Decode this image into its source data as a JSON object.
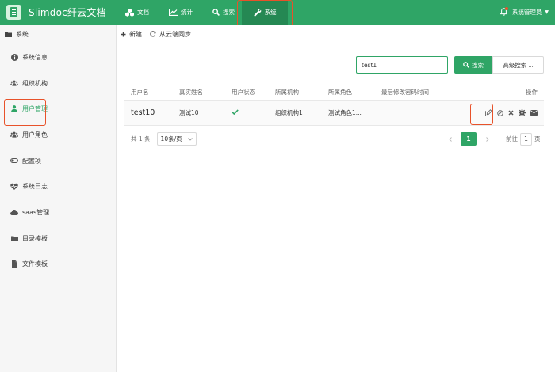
{
  "app": {
    "name": "Slimdoc纤云文档"
  },
  "nav": {
    "items": [
      {
        "label": "文档",
        "icon": "cubes-icon"
      },
      {
        "label": "统计",
        "icon": "line-chart-icon"
      },
      {
        "label": "搜索",
        "icon": "search-icon"
      },
      {
        "label": "系统",
        "icon": "wrench-icon",
        "active": true
      }
    ],
    "user": "系统管理员"
  },
  "sidebar": {
    "header": "系统",
    "items": [
      {
        "label": "系统信息",
        "icon": "info-icon"
      },
      {
        "label": "组织机构",
        "icon": "users-icon"
      },
      {
        "label": "用户管理",
        "icon": "user-icon",
        "active": true
      },
      {
        "label": "用户角色",
        "icon": "users-icon"
      },
      {
        "label": "配置项",
        "icon": "toggle-icon"
      },
      {
        "label": "系统日志",
        "icon": "heartbeat-icon"
      },
      {
        "label": "saas管理",
        "icon": "cloud-icon"
      },
      {
        "label": "目录模板",
        "icon": "folder-icon"
      },
      {
        "label": "文件模板",
        "icon": "file-icon"
      }
    ]
  },
  "toolbar": {
    "add_label": "新建",
    "sync_label": "从云端同步"
  },
  "search": {
    "value": "test1",
    "button_label": "搜索",
    "advanced_label": "高级搜索 ..."
  },
  "table": {
    "columns": [
      "用户名",
      "真实姓名",
      "用户状态",
      "所属机构",
      "所属角色",
      "最后修改密码时间",
      "操作"
    ],
    "rows": [
      {
        "username": "test10",
        "realname": "测试10",
        "status": "active",
        "org": "组织机构1",
        "role": "测试角色1...",
        "pwd_time": ""
      }
    ]
  },
  "pagination": {
    "total_label": "共 1 条",
    "page_size": "10条/页",
    "current_page": "1",
    "goto_label": "前往",
    "goto_value": "1",
    "page_suffix": "页"
  },
  "colors": {
    "brand": "#2fa566",
    "brand_dark": "#258853",
    "highlight": "#e8522a"
  }
}
